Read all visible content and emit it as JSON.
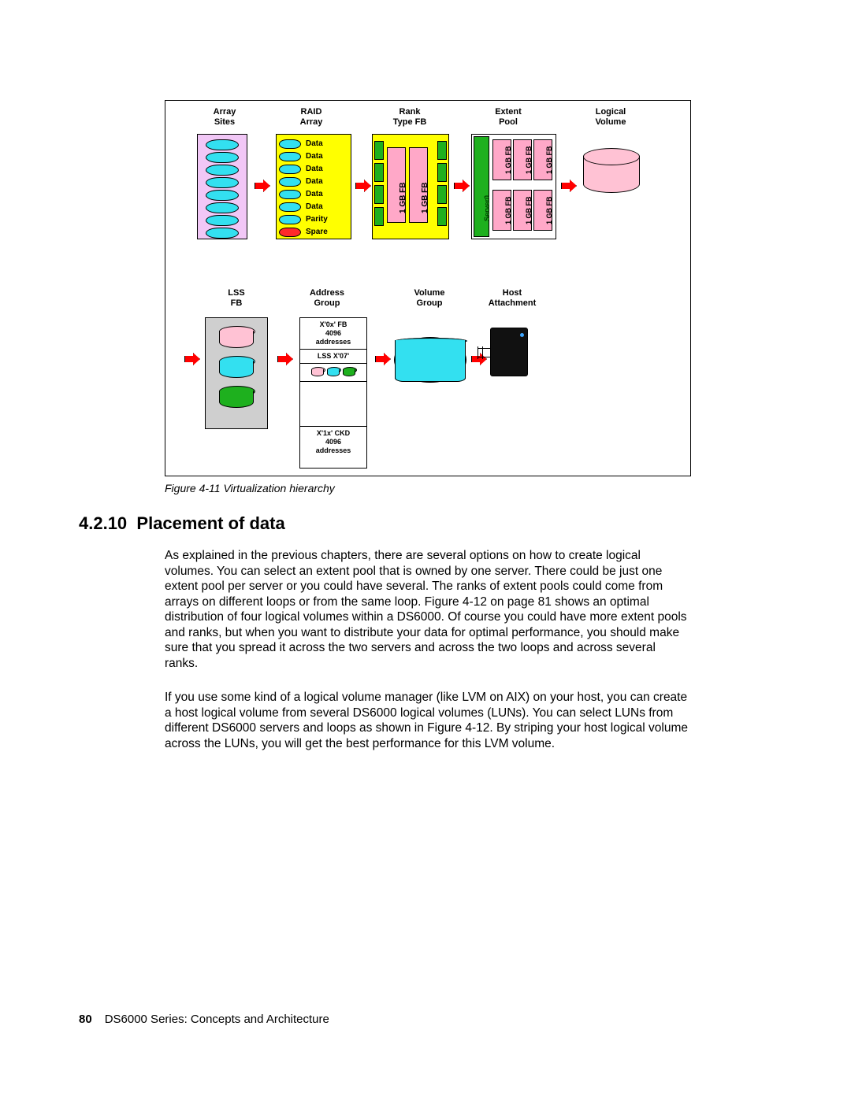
{
  "figure": {
    "headers_top": {
      "array_sites": "Array\nSites",
      "raid_array": "RAID\nArray",
      "rank": "Rank\nType FB",
      "extent_pool": "Extent\nPool",
      "logical_volume": "Logical\nVolume"
    },
    "headers_bottom": {
      "lss": "LSS\nFB",
      "address_group": "Address\nGroup",
      "volume_group": "Volume\nGroup",
      "host_attachment": "Host\nAttachment"
    },
    "raid_rows": [
      {
        "label": "Data",
        "color": "cyan"
      },
      {
        "label": "Data",
        "color": "cyan"
      },
      {
        "label": "Data",
        "color": "cyan"
      },
      {
        "label": "Data",
        "color": "cyan"
      },
      {
        "label": "Data",
        "color": "cyan"
      },
      {
        "label": "Data",
        "color": "cyan"
      },
      {
        "label": "Parity",
        "color": "cyan"
      },
      {
        "label": "Spare",
        "color": "red"
      }
    ],
    "rank_label": "1 GB FB",
    "extent_block_label": "1 GB FB",
    "server_label": "Server0",
    "address_group": {
      "top": "X'0x' FB\n4096\naddresses",
      "mid": "LSS X'07'",
      "bottom": "X'1x' CKD\n4096\naddresses"
    },
    "caption": "Figure 4-11   Virtualization hierarchy"
  },
  "section": {
    "number": "4.2.10",
    "title": "Placement of data"
  },
  "paragraphs": {
    "p1": "As explained in the previous chapters, there are several options on how to create logical volumes. You can select an extent pool that is owned by one server. There could be just one extent pool per server or you could have several. The ranks of extent pools could come from arrays on different loops or from the same loop. Figure 4-12 on page 81 shows an optimal distribution of four logical volumes within a DS6000. Of course you could have more extent pools and ranks, but when you want to distribute your data for optimal performance, you should make sure that you spread it across the two servers and across the two loops and across several ranks.",
    "p2": "If you use some kind of a logical volume manager (like LVM on AIX) on your host, you can create a host logical volume from several DS6000 logical volumes (LUNs). You can select LUNs from different DS6000 servers and loops as shown in Figure 4-12. By striping your host logical volume across the LUNs, you will get the best performance for this LVM volume."
  },
  "footer": {
    "page": "80",
    "book": "DS6000 Series: Concepts and Architecture"
  }
}
